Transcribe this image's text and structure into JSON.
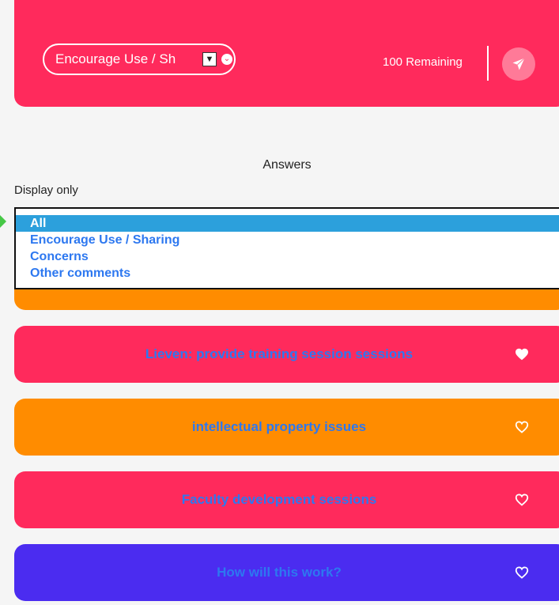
{
  "header": {
    "category_select": "Encourage Use / Sh",
    "remaining": "100 Remaining",
    "colors": {
      "header_bg": "#ff2a5c",
      "send_bg": "#ff7a98"
    },
    "icons": {
      "send": "paper-plane-icon",
      "chevron": "chevron-down-icon"
    }
  },
  "answers_title": "Answers",
  "filter": {
    "label": "Display only",
    "options": [
      "All",
      "Encourage Use / Sharing",
      "Concerns",
      "Other comments"
    ],
    "selected": "All"
  },
  "cards": [
    {
      "text": "Lieven: provide training session sessions",
      "liked": true,
      "color": "#ff2a5c"
    },
    {
      "text": "intellectual property issues",
      "liked": false,
      "color": "#ff8c00"
    },
    {
      "text": "Faculty development sessions",
      "liked": false,
      "color": "#ff2a5c"
    },
    {
      "text": "How will this work?",
      "liked": false,
      "color": "#4b2cf0"
    }
  ]
}
